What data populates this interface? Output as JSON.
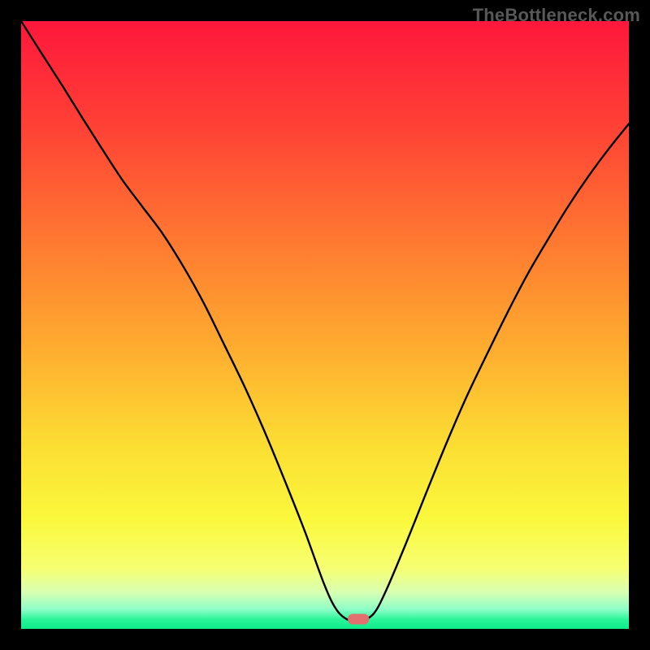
{
  "watermark": "TheBottleneck.com",
  "marker": {
    "color": "#e46f6f",
    "cx": 0.555,
    "cy": 0.984
  },
  "chart_data": {
    "type": "line",
    "title": "",
    "xlabel": "",
    "ylabel": "",
    "xlim": [
      0,
      1
    ],
    "ylim": [
      0,
      1
    ],
    "grid": false,
    "legend": false,
    "background_gradient": {
      "stops": [
        {
          "offset": 0.0,
          "color": "#fe173b"
        },
        {
          "offset": 0.18,
          "color": "#ff4335"
        },
        {
          "offset": 0.36,
          "color": "#ff7831"
        },
        {
          "offset": 0.54,
          "color": "#fead2f"
        },
        {
          "offset": 0.7,
          "color": "#fcde33"
        },
        {
          "offset": 0.82,
          "color": "#faf83c"
        },
        {
          "offset": 0.9,
          "color": "#f7ff72"
        },
        {
          "offset": 0.94,
          "color": "#d8ffb2"
        },
        {
          "offset": 0.968,
          "color": "#8effc8"
        },
        {
          "offset": 0.985,
          "color": "#28f598"
        },
        {
          "offset": 1.0,
          "color": "#0eec8a"
        }
      ]
    },
    "series": [
      {
        "name": "bottleneck-curve",
        "x": [
          0.0,
          0.033,
          0.067,
          0.1,
          0.133,
          0.167,
          0.2,
          0.233,
          0.267,
          0.3,
          0.333,
          0.367,
          0.4,
          0.433,
          0.467,
          0.5,
          0.52,
          0.54,
          0.56,
          0.58,
          0.6,
          0.633,
          0.667,
          0.7,
          0.733,
          0.767,
          0.8,
          0.833,
          0.867,
          0.9,
          0.933,
          0.967,
          1.0
        ],
        "y": [
          1.0,
          0.948,
          0.895,
          0.842,
          0.79,
          0.738,
          0.694,
          0.65,
          0.596,
          0.537,
          0.47,
          0.4,
          0.326,
          0.246,
          0.16,
          0.07,
          0.03,
          0.014,
          0.014,
          0.025,
          0.062,
          0.14,
          0.225,
          0.306,
          0.382,
          0.453,
          0.52,
          0.583,
          0.641,
          0.695,
          0.744,
          0.79,
          0.831
        ]
      }
    ],
    "annotations": [
      {
        "type": "marker-pill",
        "x": 0.555,
        "y": 0.016,
        "color": "#e46f6f"
      }
    ]
  }
}
